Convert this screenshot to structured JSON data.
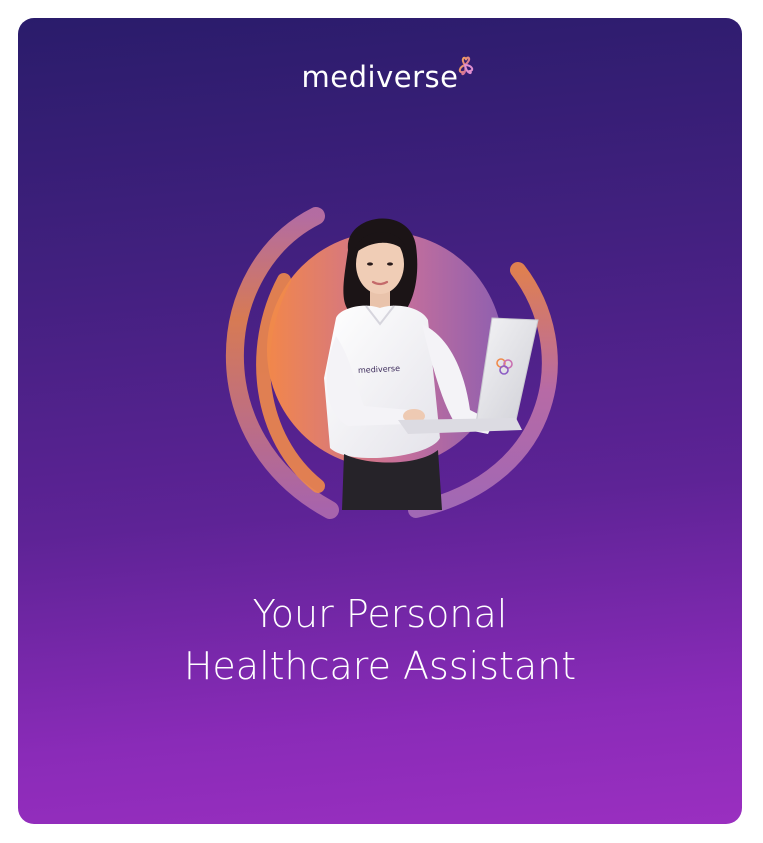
{
  "brand": {
    "name": "mediverse",
    "logo_icon": "trefoil-logo-icon",
    "shirt_logo_text": "mediverse"
  },
  "headline": {
    "line1": "Your Personal",
    "line2": "Healthcare Assistant"
  },
  "colors": {
    "background_top": "#2a1c6b",
    "background_bottom": "#9a2fc0",
    "accent_orange": "#f08a4b",
    "text": "#ffffff"
  }
}
